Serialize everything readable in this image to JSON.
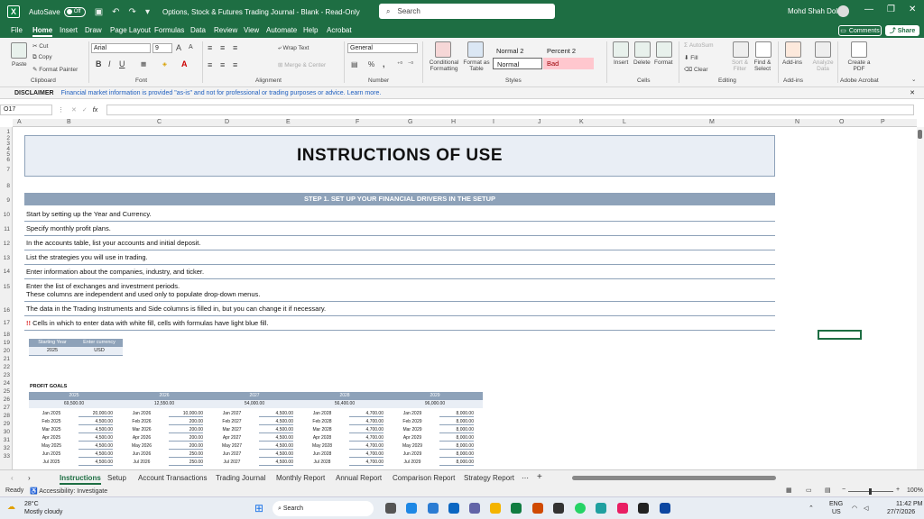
{
  "titlebar": {
    "autosave_label": "AutoSave",
    "autosave_state": "Off",
    "doc_title": "Options, Stock & Futures Trading Journal - Blank  -  Read-Only",
    "search_placeholder": "Search",
    "user_name": "Mohd Shah Dolah"
  },
  "ribbon_tabs": [
    "File",
    "Home",
    "Insert",
    "Draw",
    "Page Layout",
    "Formulas",
    "Data",
    "Review",
    "View",
    "Automate",
    "Help",
    "Acrobat"
  ],
  "comments_label": "Comments",
  "share_label": "Share",
  "ribbon": {
    "clipboard": {
      "paste": "Paste",
      "cut": "Cut",
      "copy": "Copy",
      "format_painter": "Format Painter",
      "group": "Clipboard"
    },
    "font": {
      "name": "Arial",
      "size": "9",
      "group": "Font",
      "bold": "B",
      "italic": "I",
      "underline": "U"
    },
    "alignment": {
      "wrap": "Wrap Text",
      "merge": "Merge & Center",
      "group": "Alignment"
    },
    "number": {
      "format": "General",
      "group": "Number",
      "percent": "%",
      "comma": ","
    },
    "styles": {
      "conditional": "Conditional Formatting",
      "format_table": "Format as Table",
      "normal2": "Normal 2",
      "percent2": "Percent 2",
      "normal": "Normal",
      "bad": "Bad",
      "group": "Styles"
    },
    "cells": {
      "insert": "Insert",
      "delete": "Delete",
      "format": "Format",
      "group": "Cells"
    },
    "editing": {
      "autosum": "AutoSum",
      "fill": "Fill",
      "clear": "Clear",
      "sort": "Sort & Filter",
      "find": "Find & Select",
      "group": "Editing"
    },
    "addins": {
      "label": "Add-ins",
      "analyze": "Analyze Data",
      "group": "Add-ins"
    },
    "acrobat": {
      "create": "Create a PDF",
      "group": "Adobe Acrobat"
    }
  },
  "disclaimer": {
    "label": "DISCLAIMER",
    "text": "Financial market information is provided \"as-is\" and not for professional or trading purposes or advice. Learn more."
  },
  "formula_bar": {
    "name_box": "O17",
    "fx": "fx",
    "value": ""
  },
  "columns": [
    "A",
    "B",
    "C",
    "D",
    "E",
    "F",
    "G",
    "H",
    "I",
    "J",
    "K",
    "L",
    "M",
    "N",
    "O",
    "P"
  ],
  "rows": [
    "1",
    "2",
    "3",
    "4",
    "5",
    "6",
    "7",
    "8",
    "9",
    "10",
    "11",
    "12",
    "13",
    "14",
    "15",
    "16",
    "17",
    "18",
    "19",
    "20",
    "21",
    "22",
    "23",
    "24",
    "25",
    "26",
    "27",
    "28",
    "29",
    "30",
    "31",
    "32",
    "33"
  ],
  "sheet": {
    "title": "INSTRUCTIONS OF USE",
    "step1": "STEP 1. SET UP YOUR FINANCIAL DRIVERS IN THE SETUP",
    "instructions": [
      "Start by setting up the Year and Currency.",
      "Specify monthly profit plans.",
      "In the accounts table, list your accounts and initial deposit.",
      "List the strategies you will use in trading.",
      "Enter information about the companies, industry, and ticker.",
      "Enter the list of exchanges and investment periods.",
      "These columns are independent and used only to populate drop-down menus.",
      "The data in the Trading Instruments and Side columns is filled in, but you can change it if necessary.",
      "Cells in which to enter data with white fill, cells with formulas have light blue fill."
    ],
    "note_mark": "!!",
    "settings": {
      "h1": "Starting Year",
      "h2": "Enter currency",
      "v1": "2025",
      "v2": "USD"
    },
    "goals": {
      "title": "PROFIT GOALS",
      "years": [
        "2025",
        "2026",
        "2027",
        "2028",
        "2029"
      ],
      "totals": [
        "69,500.00",
        "12,550.00",
        "54,000.00",
        "56,400.00",
        "96,000.00"
      ],
      "rows": [
        [
          "Jan 2025",
          "20,000.00",
          "Jan 2026",
          "10,000.00",
          "Jan 2027",
          "4,500.00",
          "Jan 2028",
          "4,700.00",
          "Jan 2029",
          "8,000.00"
        ],
        [
          "Feb 2025",
          "4,500.00",
          "Feb 2026",
          "200.00",
          "Feb 2027",
          "4,500.00",
          "Feb 2028",
          "4,700.00",
          "Feb 2029",
          "8,000.00"
        ],
        [
          "Mar 2025",
          "4,500.00",
          "Mar 2026",
          "200.00",
          "Mar 2027",
          "4,500.00",
          "Mar 2028",
          "4,700.00",
          "Mar 2029",
          "8,000.00"
        ],
        [
          "Apr 2025",
          "4,500.00",
          "Apr 2026",
          "200.00",
          "Apr 2027",
          "4,500.00",
          "Apr 2028",
          "4,700.00",
          "Apr 2029",
          "8,000.00"
        ],
        [
          "May 2025",
          "4,500.00",
          "May 2026",
          "200.00",
          "May 2027",
          "4,500.00",
          "May 2028",
          "4,700.00",
          "May 2029",
          "8,000.00"
        ],
        [
          "Jun 2025",
          "4,500.00",
          "Jun 2026",
          "250.00",
          "Jun 2027",
          "4,500.00",
          "Jun 2028",
          "4,700.00",
          "Jun 2029",
          "8,000.00"
        ],
        [
          "Jul 2025",
          "4,500.00",
          "Jul 2026",
          "250.00",
          "Jul 2027",
          "4,500.00",
          "Jul 2028",
          "4,700.00",
          "Jul 2029",
          "8,000.00"
        ]
      ]
    }
  },
  "sheet_tabs": [
    "Instructions",
    "Setup",
    "Account Transactions",
    "Trading Journal",
    "Monthly Report",
    "Annual Report",
    "Comparison Report",
    "Strategy Report"
  ],
  "status": {
    "ready": "Ready",
    "accessibility": "Accessibility: Investigate",
    "zoom": "100%"
  },
  "taskbar": {
    "temp": "28°C",
    "weather": "Mostly cloudy",
    "search": "Search",
    "lang1": "ENG",
    "lang2": "US",
    "time": "11:42 PM",
    "date": "27/7/2026"
  },
  "colors": {
    "excel_green": "#1e6e43",
    "header_blue": "#8ea2b9",
    "light_blue": "#e9eef5",
    "bad_fill": "#ffc7ce"
  }
}
